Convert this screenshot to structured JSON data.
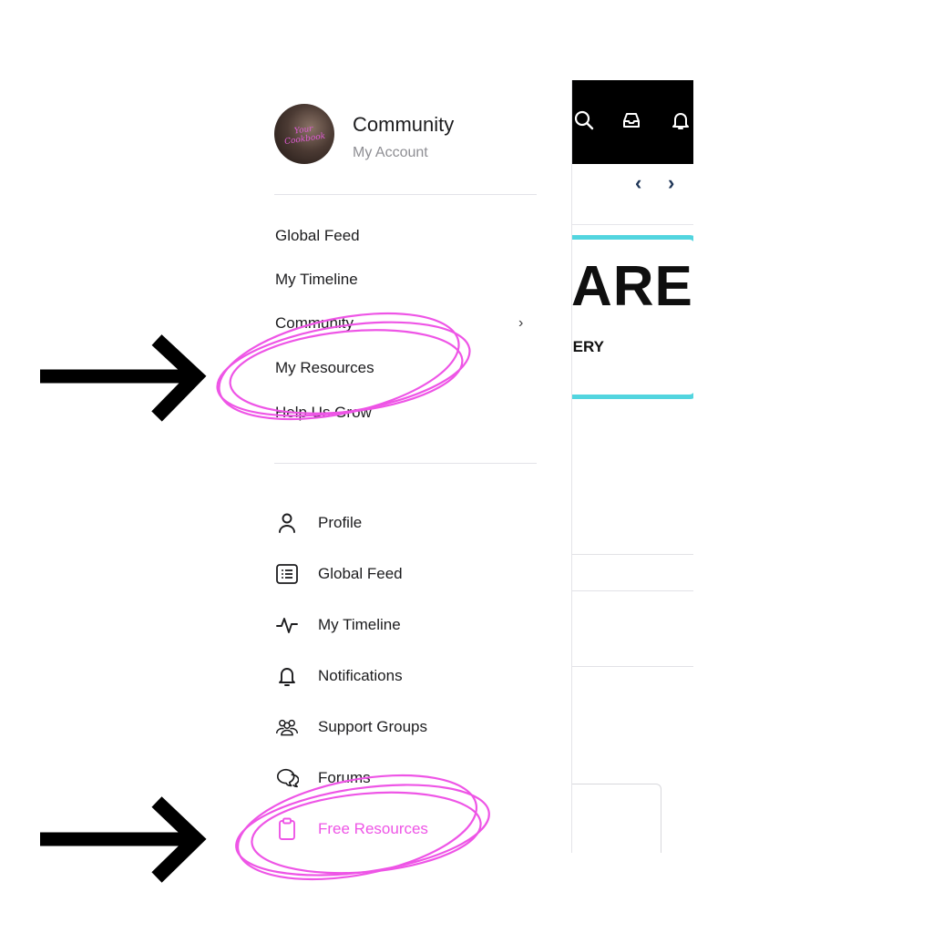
{
  "account": {
    "name": "Community",
    "subtitle": "My Account",
    "avatar_script": "Your Cookbook"
  },
  "menu": [
    {
      "label": "Global Feed"
    },
    {
      "label": "My Timeline"
    },
    {
      "label": "Community",
      "chevron": "›"
    },
    {
      "label": "My Resources"
    },
    {
      "label": "Help Us Grow"
    }
  ],
  "icon_menu": [
    {
      "label": "Profile",
      "icon": "person-icon"
    },
    {
      "label": "Global Feed",
      "icon": "list-icon"
    },
    {
      "label": "My Timeline",
      "icon": "activity-icon"
    },
    {
      "label": "Notifications",
      "icon": "bell-icon"
    },
    {
      "label": "Support Groups",
      "icon": "group-icon"
    },
    {
      "label": "Forums",
      "icon": "chat-icon"
    },
    {
      "label": "Free Resources",
      "icon": "clipboard-icon",
      "active": true
    }
  ],
  "background_app": {
    "banner_title": "ARE",
    "banner_sub": "ERY",
    "nav_prev": "‹",
    "nav_next": "›"
  },
  "colors": {
    "accent": "#ee55e6",
    "banner_border": "#52d5df",
    "topbar": "#000000"
  }
}
